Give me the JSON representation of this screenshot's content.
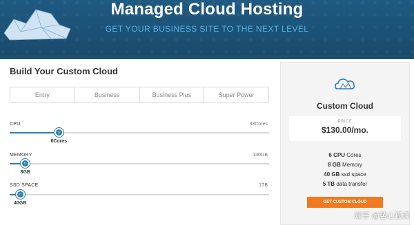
{
  "hero": {
    "title": "Managed Cloud Hosting",
    "subtitle": "GET YOUR BUSINESS SITE TO THE NEXT LEVEL",
    "icon": "cloud-icon"
  },
  "builder": {
    "title": "Build Your Custom Cloud",
    "tabs": [
      {
        "label": "Entry"
      },
      {
        "label": "Business"
      },
      {
        "label": "Business Plus"
      },
      {
        "label": "Super Power"
      }
    ],
    "sliders": [
      {
        "label": "CPU",
        "max_label": "33Cores",
        "value_label": "6Cores",
        "fraction": 0.19
      },
      {
        "label": "MEMORY",
        "max_label": "130GB",
        "value_label": "8GB",
        "fraction": 0.06
      },
      {
        "label": "SSD SPACE",
        "max_label": "1TB",
        "value_label": "40GB",
        "fraction": 0.04
      }
    ]
  },
  "plan": {
    "icon": "cloud-icon",
    "title": "Custom Cloud",
    "price_label": "PRICE",
    "price_value": "$130.00/mo.",
    "specs": [
      {
        "amount": "6 CPU",
        "unit": "Cores"
      },
      {
        "amount": "8 GB",
        "unit": "Memory"
      },
      {
        "amount": "40 GB",
        "unit": "ssd space"
      },
      {
        "amount": "5 TB",
        "unit": "data transfer"
      }
    ],
    "button_label": "GET CUSTOM CLOUD"
  },
  "watermark": "知乎 @苦心孤译",
  "colors": {
    "accent": "#2b7fb3",
    "button": "#f07a1f",
    "hero_bg": "#1d4f73",
    "subtitle": "#4fb4e6"
  }
}
